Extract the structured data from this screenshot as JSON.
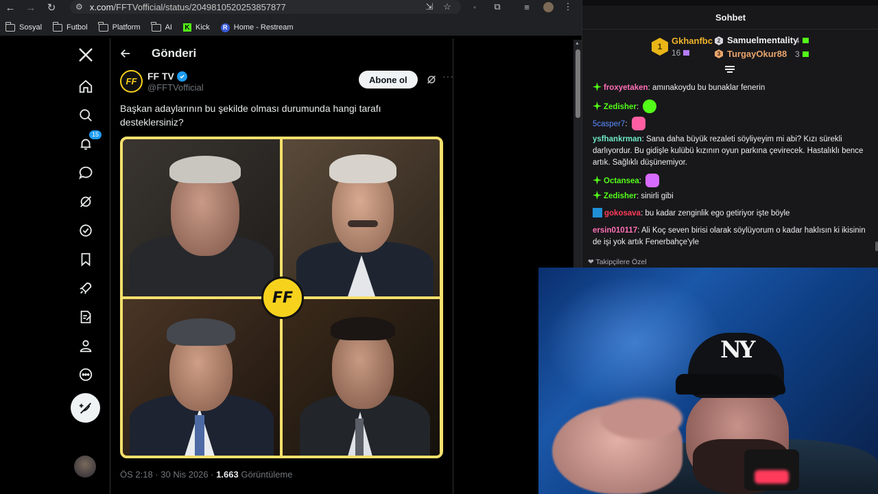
{
  "browser": {
    "url_host": "x.com",
    "url_path": "/FFTVofficial/status/2049810520253857877",
    "bookmarks": [
      {
        "label": "Sosyal",
        "icon": "folder-icon"
      },
      {
        "label": "Futbol",
        "icon": "folder-icon"
      },
      {
        "label": "Platform",
        "icon": "folder-icon"
      },
      {
        "label": "AI",
        "icon": "folder-icon"
      },
      {
        "label": "Kick",
        "icon": "kick-icon"
      },
      {
        "label": "Home - Restream",
        "icon": "restream-icon"
      }
    ]
  },
  "x": {
    "notification_count": "15",
    "header_title": "Gönderi",
    "author_name": "FF TV",
    "author_handle": "@FFTVofficial",
    "follow_label": "Abone ol",
    "tweet_text": "Başkan adaylarının bu şekilde olması durumunda hangi tarafı desteklersiniz?",
    "media_logo_text": "FF",
    "time": "ÖS 2:18 · 30 Nis 2026 · ",
    "views_count": "1.663",
    "views_label": " Görüntüleme"
  },
  "chat": {
    "title": "Sohbet",
    "leaderboard": [
      {
        "rank": "1",
        "name": "Gkhanfbc",
        "count": "16",
        "color": "#f0b429"
      },
      {
        "rank": "2",
        "name": "Samuelmentality",
        "count": "4",
        "color": "#d5d5dd"
      },
      {
        "rank": "3",
        "name": "TurgayOkur88",
        "count": "3",
        "color": "#e9a56d"
      }
    ],
    "messages": [
      {
        "user": "froxyetaken",
        "color": "#ff6fb5",
        "text": "amınakoydu bu bunaklar fenerin"
      },
      {
        "user": "Zedisher",
        "color": "#53fc18",
        "text": ""
      },
      {
        "user": "5casper7",
        "color": "#5a8cff",
        "text": ""
      },
      {
        "user": "ysfhankrman",
        "color": "#6ee7c7",
        "text": "Sana daha büyük rezaleti söyliyeyim mi abi? Kızı sürekli darlıyordur. Bu gidişle kulübü kızının oyun parkına çevirecek. Hastalıklı bence artık. Sağlıklı düşünemiyor."
      },
      {
        "user": "Octansea",
        "color": "#53fc18",
        "text": ""
      },
      {
        "user": "Zedisher",
        "color": "#53fc18",
        "text": "sinirli gibi"
      },
      {
        "user": "gokosava",
        "color": "#ff3b5c",
        "text": "bu kadar zenginlik ego getiriyor işte böyle"
      },
      {
        "user": "ersin010117",
        "color": "#ff6fb5",
        "text": "Ali Koç seven birisi olarak söylüyorum o kadar haklısın ki ikisinin de işi yok artık Fenerbahçe'yle"
      }
    ],
    "followers_only": "Takipçilere Özel"
  },
  "webcam": {
    "cap_logo": "NY"
  }
}
